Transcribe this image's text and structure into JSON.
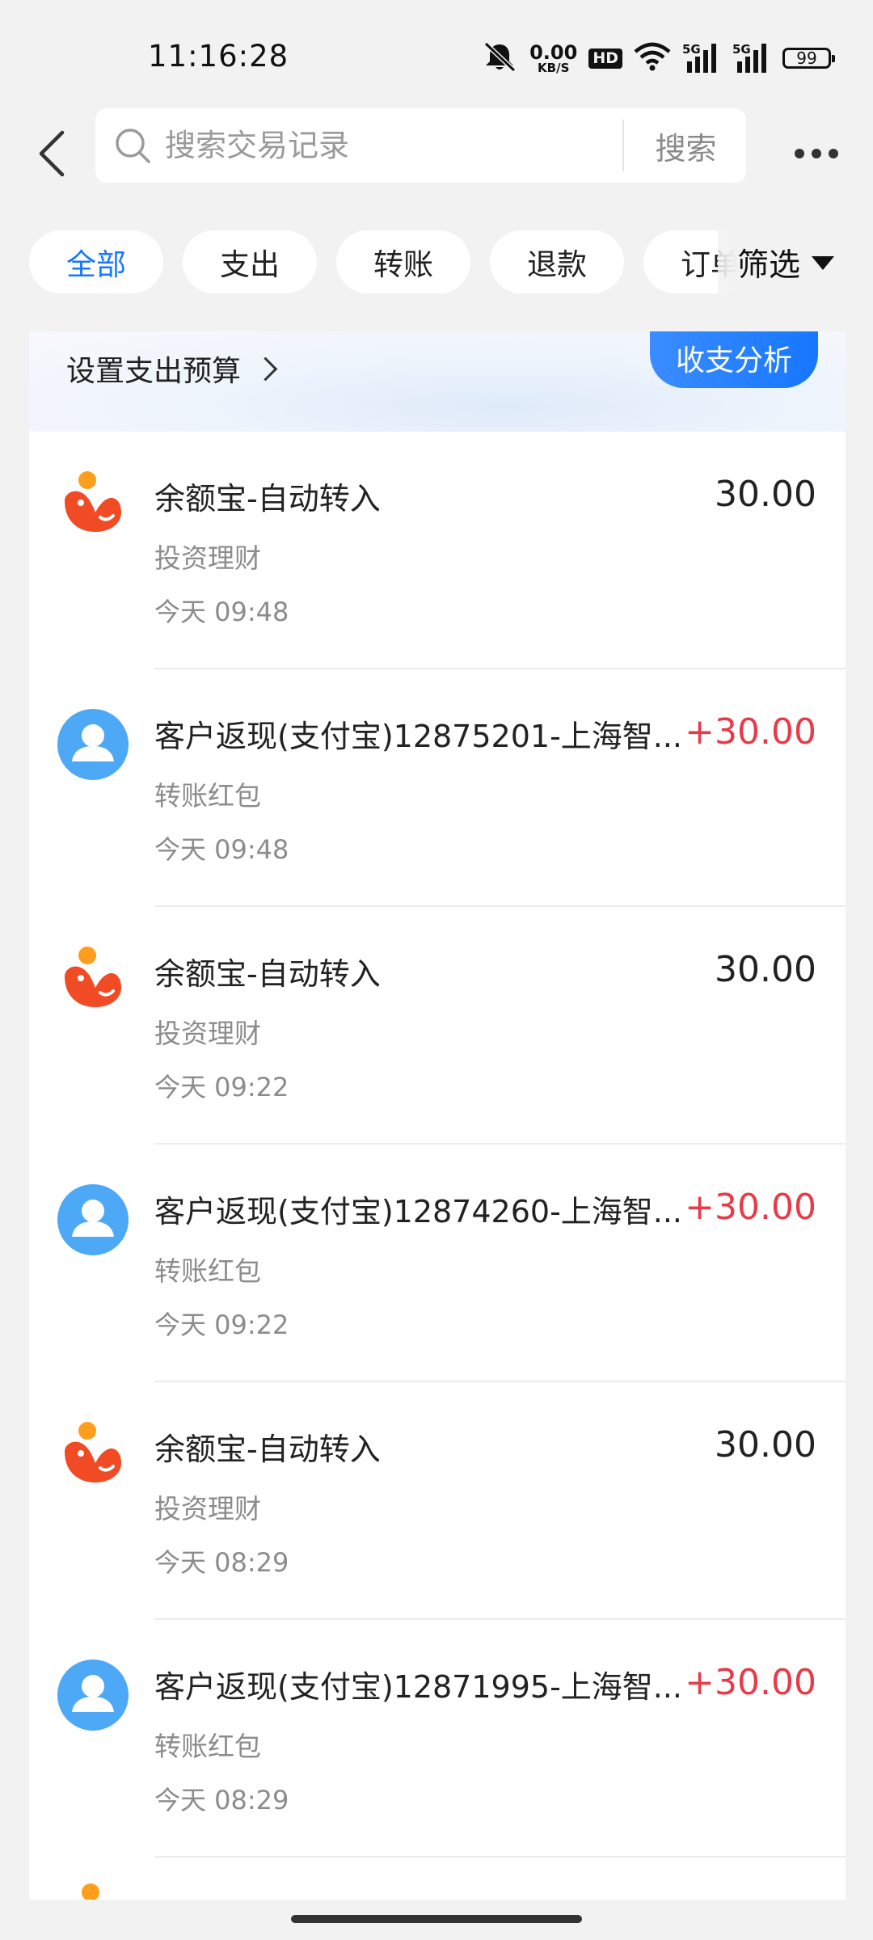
{
  "status_bar": {
    "time": "11:16:28",
    "net_speed_value": "0.00",
    "net_speed_unit": "KB/S",
    "hd_label": "HD",
    "signal_1": "5G",
    "signal_2": "5G",
    "battery": "99"
  },
  "header": {
    "search_placeholder": "搜索交易记录",
    "search_button": "搜索"
  },
  "tabs": [
    {
      "label": "全部",
      "active": true
    },
    {
      "label": "支出",
      "active": false
    },
    {
      "label": "转账",
      "active": false
    },
    {
      "label": "退款",
      "active": false
    },
    {
      "label": "订单",
      "active": false
    }
  ],
  "filter": {
    "label": "筛选"
  },
  "budget": {
    "link_label": "设置支出预算",
    "analysis_button": "收支分析"
  },
  "transactions": [
    {
      "icon": "yuebao-icon",
      "title": "余额宝-自动转入",
      "category": "投资理财",
      "time": "今天 09:48",
      "amount": "30.00",
      "type": "neutral"
    },
    {
      "icon": "user-avatar-icon",
      "title": "客户返现(支付宝)12875201-上海智...",
      "category": "转账红包",
      "time": "今天 09:48",
      "amount": "+30.00",
      "type": "income"
    },
    {
      "icon": "yuebao-icon",
      "title": "余额宝-自动转入",
      "category": "投资理财",
      "time": "今天 09:22",
      "amount": "30.00",
      "type": "neutral"
    },
    {
      "icon": "user-avatar-icon",
      "title": "客户返现(支付宝)12874260-上海智...",
      "category": "转账红包",
      "time": "今天 09:22",
      "amount": "+30.00",
      "type": "income"
    },
    {
      "icon": "yuebao-icon",
      "title": "余额宝-自动转入",
      "category": "投资理财",
      "time": "今天 08:29",
      "amount": "30.00",
      "type": "neutral"
    },
    {
      "icon": "user-avatar-icon",
      "title": "客户返现(支付宝)12871995-上海智...",
      "category": "转账红包",
      "time": "今天 08:29",
      "amount": "+30.00",
      "type": "income"
    }
  ],
  "colors": {
    "accent": "#1677ff",
    "income": "#e63c4a",
    "yuebao_red": "#f04b25",
    "yuebao_orange": "#ff9d1c",
    "avatar_blue": "#4da8f5"
  }
}
